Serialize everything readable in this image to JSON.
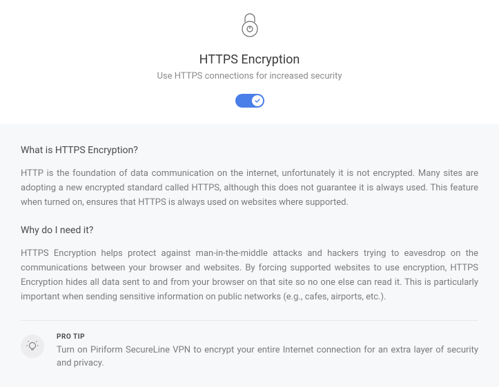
{
  "header": {
    "title": "HTTPS Encryption",
    "subtitle": "Use HTTPS connections for increased security",
    "toggle_on": true
  },
  "content": {
    "section1_heading": "What is HTTPS Encryption?",
    "section1_text": "HTTP is the foundation of data communication on the internet, unfortunately it is not encrypted. Many sites are adopting a new encrypted standard called HTTPS, although this does not guarantee it is always used. This feature when turned on, ensures that HTTPS is always used on websites where supported.",
    "section2_heading": "Why do I need it?",
    "section2_text": "HTTPS Encryption helps protect against man-in-the-middle attacks and hackers trying to eavesdrop on the communications between your browser and websites. By forcing supported websites to use encryption, HTTPS Encryption hides all data sent to and from your browser on that site so no one else can read it. This is particularly important when sending sensitive information on public networks (e.g., cafes, airports, etc.)."
  },
  "protip": {
    "label": "PRO TIP",
    "text": "Turn on Piriform SecureLine VPN to encrypt your entire Internet connection for an extra layer of security and privacy."
  }
}
